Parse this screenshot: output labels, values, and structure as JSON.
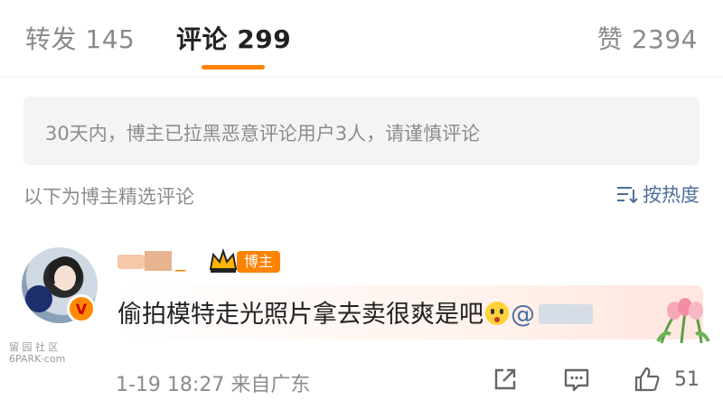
{
  "tabs": [
    {
      "label": "转发",
      "count": "145"
    },
    {
      "label": "评论",
      "count": "299"
    },
    {
      "label": "赞",
      "count": "2394"
    }
  ],
  "notice": {
    "text": "30天内，博主已拉黑恶意评论用户3人，请谨慎评论"
  },
  "filter": {
    "label": "以下为博主精选评论",
    "sort_label": "按热度"
  },
  "comment": {
    "username_suffix": "_",
    "role_tag": "博主",
    "text": "偷拍模特走光照片拿去卖很爽是吧",
    "mention": "@",
    "timestamp": "1-19 18:27",
    "source": "来自广东",
    "like_count": "51"
  },
  "watermark": {
    "line1": "留 园 社 区",
    "line2": "6PARK·com"
  },
  "colors": {
    "accent": "#ff8200",
    "link": "#4e6e9a"
  }
}
